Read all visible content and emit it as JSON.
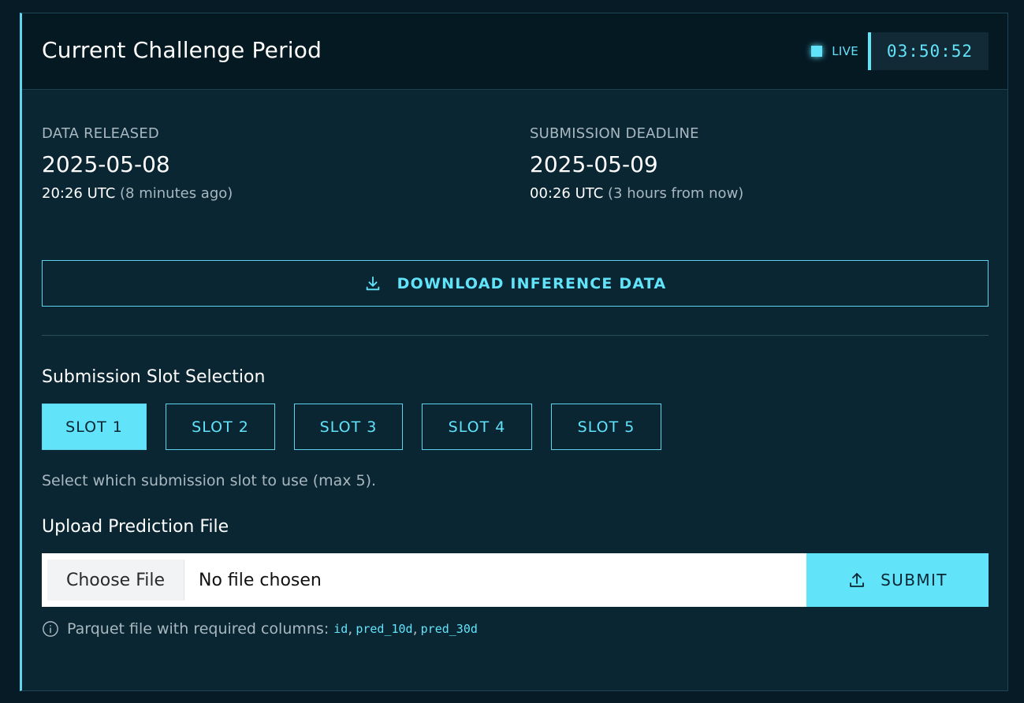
{
  "header": {
    "title": "Current Challenge Period",
    "live_label": "LIVE",
    "timer": "03:50:52"
  },
  "data_released": {
    "label": "DATA RELEASED",
    "date": "2025-05-08",
    "time": "20:26 UTC",
    "relative": "(8 minutes ago)"
  },
  "submission_deadline": {
    "label": "SUBMISSION DEADLINE",
    "date": "2025-05-09",
    "time": "00:26 UTC",
    "relative": "(3 hours from now)"
  },
  "download": {
    "label": "DOWNLOAD INFERENCE DATA",
    "icon": "download-icon"
  },
  "slots": {
    "title": "Submission Slot Selection",
    "items": [
      {
        "label": "SLOT 1",
        "active": true
      },
      {
        "label": "SLOT 2",
        "active": false
      },
      {
        "label": "SLOT 3",
        "active": false
      },
      {
        "label": "SLOT 4",
        "active": false
      },
      {
        "label": "SLOT 5",
        "active": false
      }
    ],
    "hint": "Select which submission slot to use (max 5)."
  },
  "upload": {
    "title": "Upload Prediction File",
    "choose_label": "Choose File",
    "no_file_label": "No file chosen",
    "submit_label": "SUBMIT",
    "note_text": "Parquet file with required columns:",
    "columns": [
      "id",
      "pred_10d",
      "pred_30d"
    ],
    "separator": ","
  },
  "colors": {
    "accent": "#61e3fa",
    "background": "#071b26",
    "panel": "#0a2633"
  }
}
